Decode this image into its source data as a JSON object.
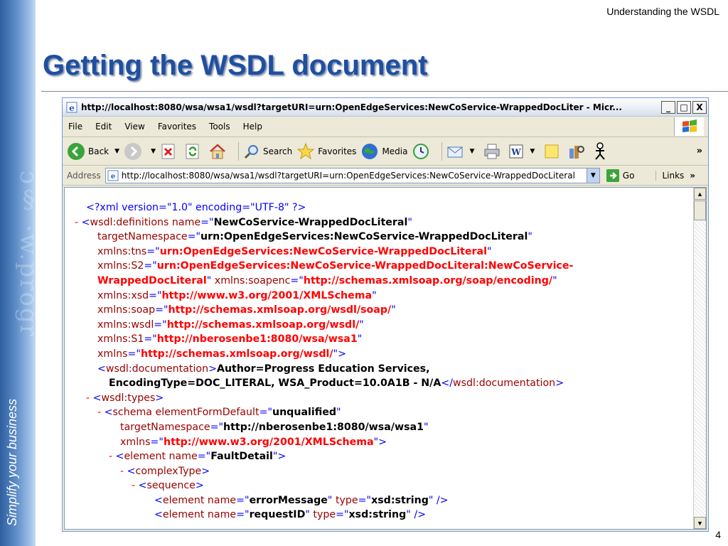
{
  "slide": {
    "header_text": "Understanding the WSDL",
    "title": "Getting the WSDL document",
    "slogan": "Simplify your business",
    "page_number": "4"
  },
  "window": {
    "title": "http://localhost:8080/wsa/wsa1/wsdl?targetURI=urn:OpenEdgeServices:NewCoService-WrappedDocLiter - Micr...",
    "controls": {
      "minimize": "_",
      "maximize": "□",
      "close": "X"
    }
  },
  "menu": [
    "File",
    "Edit",
    "View",
    "Favorites",
    "Tools",
    "Help"
  ],
  "toolbar": {
    "back": "Back",
    "search": "Search",
    "favorites": "Favorites",
    "media": "Media",
    "more": "»"
  },
  "address": {
    "label": "Address",
    "url": "http://localhost:8080/wsa/wsa1/wsdl?targetURI=urn:OpenEdgeServices:NewCoService-WrappedDocLiteral",
    "go": "Go",
    "links": "Links",
    "more": "»"
  },
  "xml_lines": {
    "l1": "<?xml version=\"1.0\" encoding=\"UTF-8\" ?>",
    "l2_attr": "wsdl:definitions name",
    "l2_val": "NewCoService-WrappedDocLiteral",
    "l3_attr": "targetNamespace",
    "l3_val": "urn:OpenEdgeServices:NewCoService-WrappedDocLiteral",
    "l4_attr": "xmlns:tns",
    "l4_val": "urn:OpenEdgeServices:NewCoService-WrappedDocLiteral",
    "l5_attr": "xmlns:S2",
    "l5_val": "urn:OpenEdgeServices:NewCoService-WrappedDocLiteral:NewCoService-",
    "l6_val": "WrappedDocLiteral",
    "l6_attr": "xmlns:soapenc",
    "l6_val2": "http://schemas.xmlsoap.org/soap/encoding/",
    "l7_attr": "xmlns:xsd",
    "l7_val": "http://www.w3.org/2001/XMLSchema",
    "l8_attr": "xmlns:soap",
    "l8_val": "http://schemas.xmlsoap.org/wsdl/soap/",
    "l9_attr": "xmlns:wsdl",
    "l9_val": "http://schemas.xmlsoap.org/wsdl/",
    "l10_attr": "xmlns:S1",
    "l10_val": "http://nberosenbe1:8080/wsa/wsa1",
    "l11_attr": "xmlns",
    "l11_val": "http://schemas.xmlsoap.org/wsdl/",
    "l12_tag": "wsdl:documentation",
    "l12_text": "Author=Progress Education Services,",
    "l13_text": "EncodingType=DOC_LITERAL, WSA_Product=10.0A1B - N/A",
    "l13_close": "wsdl:documentation",
    "l14_tag": "wsdl:types",
    "l15_attr": "schema elementFormDefault",
    "l15_val": "unqualified",
    "l16_attr": "targetNamespace",
    "l16_val": "http://nberosenbe1:8080/wsa/wsa1",
    "l17_attr": "xmlns",
    "l17_val": "http://www.w3.org/2001/XMLSchema",
    "l18_attr": "element name",
    "l18_val": "FaultDetail",
    "l19_tag": "complexType",
    "l20_tag": "sequence",
    "l21_attr": "element name",
    "l21_val": "errorMessage",
    "l21_attr2": "type",
    "l21_val2": "xsd:string",
    "l22_attr": "element name",
    "l22_val": "requestID",
    "l22_attr2": "type",
    "l22_val2": "xsd:string"
  }
}
